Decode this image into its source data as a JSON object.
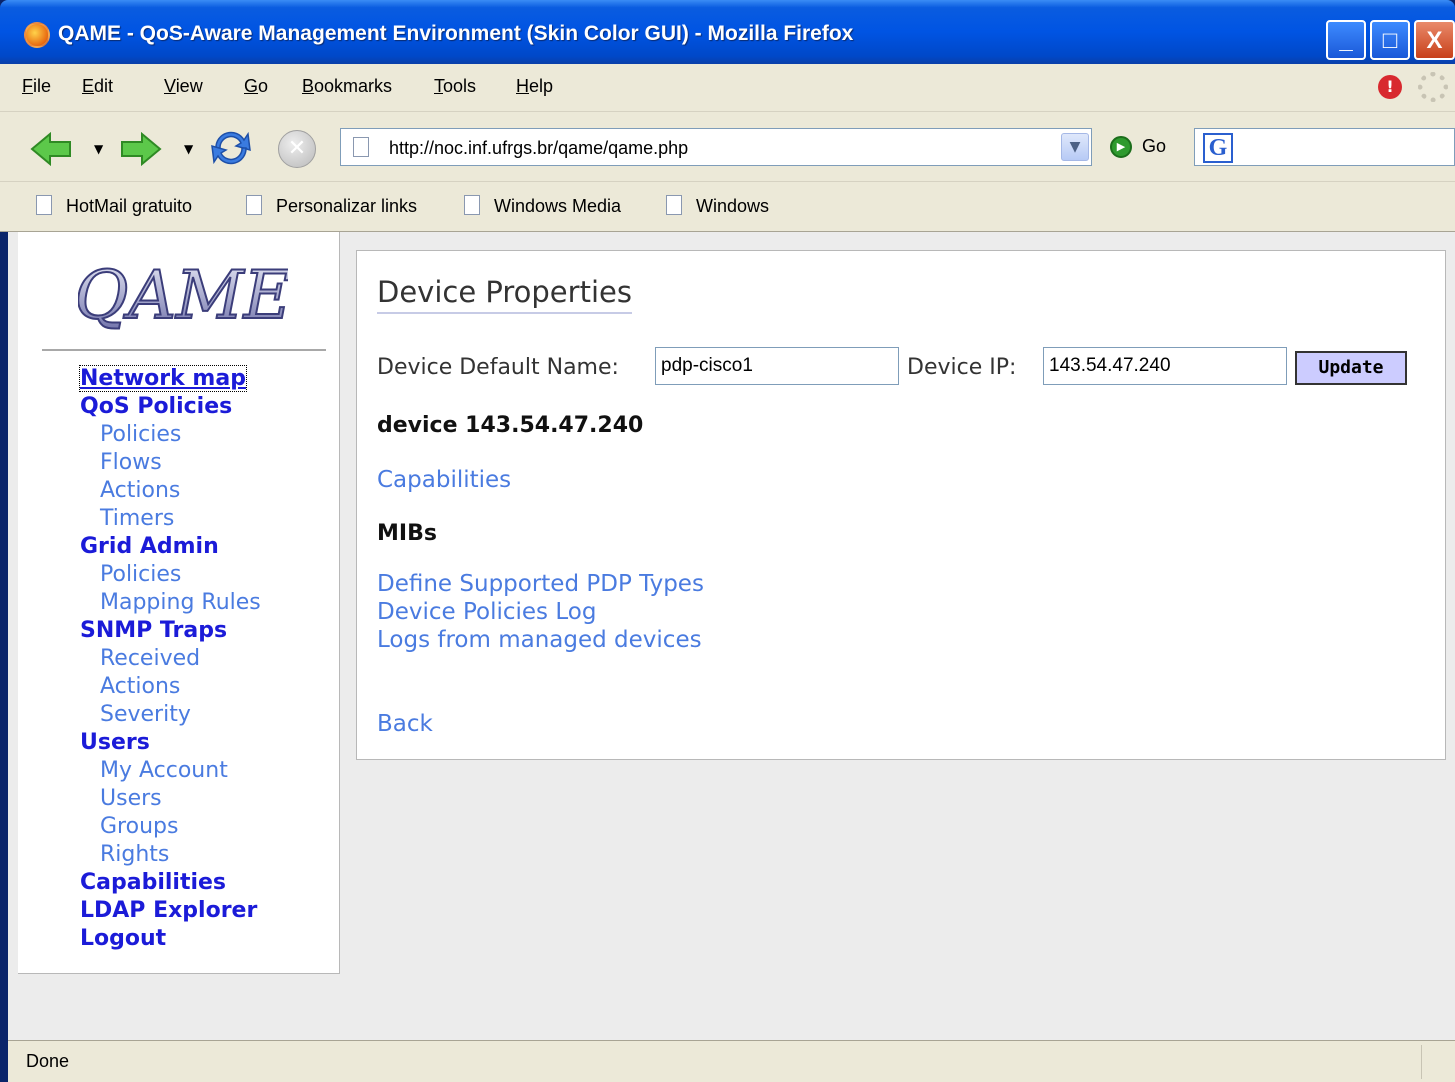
{
  "window": {
    "title": "QAME - QoS-Aware Management Environment (Skin Color GUI) - Mozilla Firefox",
    "minimize": "_",
    "maximize": "□",
    "close": "X"
  },
  "menu": {
    "items": [
      {
        "accel": "F",
        "rest": "ile"
      },
      {
        "accel": "E",
        "rest": "dit"
      },
      {
        "accel": "V",
        "rest": "iew"
      },
      {
        "accel": "G",
        "rest": "o"
      },
      {
        "accel": "B",
        "rest": "ookmarks"
      },
      {
        "accel": "T",
        "rest": "ools"
      },
      {
        "accel": "H",
        "rest": "elp"
      }
    ]
  },
  "toolbar": {
    "url": "http://noc.inf.ufrgs.br/qame/qame.php",
    "go_label": "Go",
    "search_icon_letter": "G"
  },
  "bookmarks": [
    "HotMail gratuito",
    "Personalizar links",
    "Windows Media",
    "Windows"
  ],
  "sidebar": {
    "logo_text": "QAME",
    "items": [
      {
        "label": "Network map",
        "level": "header"
      },
      {
        "label": "QoS Policies",
        "level": "header"
      },
      {
        "label": "Policies",
        "level": "sub"
      },
      {
        "label": "Flows",
        "level": "sub"
      },
      {
        "label": "Actions",
        "level": "sub"
      },
      {
        "label": "Timers",
        "level": "sub"
      },
      {
        "label": "Grid Admin",
        "level": "header"
      },
      {
        "label": "Policies",
        "level": "sub"
      },
      {
        "label": "Mapping Rules",
        "level": "sub"
      },
      {
        "label": "SNMP Traps",
        "level": "header"
      },
      {
        "label": "Received",
        "level": "sub"
      },
      {
        "label": "Actions",
        "level": "sub"
      },
      {
        "label": "Severity",
        "level": "sub"
      },
      {
        "label": "Users",
        "level": "header"
      },
      {
        "label": "My Account",
        "level": "sub"
      },
      {
        "label": "Users",
        "level": "sub"
      },
      {
        "label": "Groups",
        "level": "sub"
      },
      {
        "label": "Rights",
        "level": "sub"
      },
      {
        "label": "Capabilities",
        "level": "header"
      },
      {
        "label": "LDAP Explorer",
        "level": "header"
      },
      {
        "label": "Logout",
        "level": "header"
      }
    ]
  },
  "content": {
    "title": "Device Properties",
    "name_label": "Device Default Name:",
    "name_value": "pdp-cisco1",
    "ip_label": "Device IP:",
    "ip_value": "143.54.47.240",
    "update_label": "Update",
    "device_heading": "device 143.54.47.240",
    "capabilities_link": "Capabilities",
    "mibs_heading": "MIBs",
    "links": [
      "Define Supported PDP Types",
      "Device Policies Log",
      "Logs from managed devices"
    ],
    "back_link": "Back"
  },
  "status": {
    "text": "Done"
  }
}
